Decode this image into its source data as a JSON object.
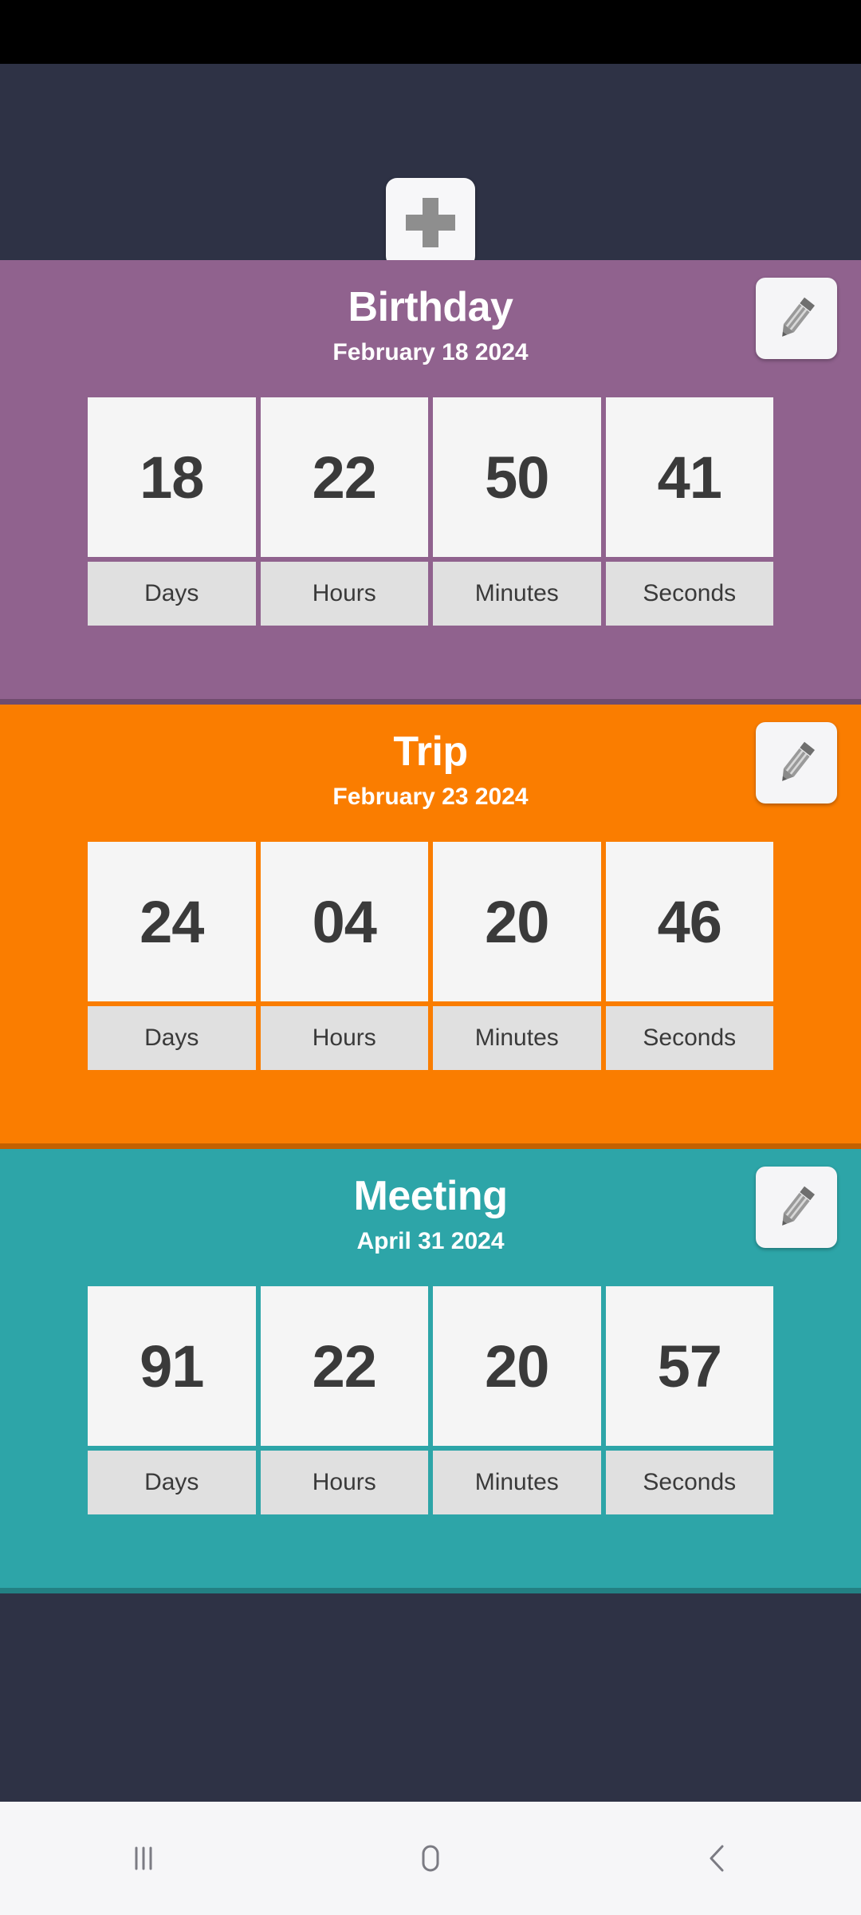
{
  "app": {
    "background_color": "#2e3245",
    "status_bar_color": "#000000"
  },
  "header": {
    "add_button_label": "+",
    "add_button_icon": "plus-icon",
    "button_background": "#f7f7f9",
    "icon_color": "#8e8e8e"
  },
  "cards": [
    {
      "title": "Birthday",
      "date": "February 18 2024",
      "color": "#90628e",
      "edit_icon": "pencil-icon",
      "countdown": [
        {
          "value": "18",
          "label": "Days"
        },
        {
          "value": "22",
          "label": "Hours"
        },
        {
          "value": "50",
          "label": "Minutes"
        },
        {
          "value": "41",
          "label": "Seconds"
        }
      ]
    },
    {
      "title": "Trip",
      "date": "February 23 2024",
      "color": "#fa7d00",
      "edit_icon": "pencil-icon",
      "countdown": [
        {
          "value": "24",
          "label": "Days"
        },
        {
          "value": "04",
          "label": "Hours"
        },
        {
          "value": "20",
          "label": "Minutes"
        },
        {
          "value": "46",
          "label": "Seconds"
        }
      ]
    },
    {
      "title": "Meeting",
      "date": "April 31 2024",
      "color": "#2da5a8",
      "edit_icon": "pencil-icon",
      "countdown": [
        {
          "value": "91",
          "label": "Days"
        },
        {
          "value": "22",
          "label": "Hours"
        },
        {
          "value": "20",
          "label": "Minutes"
        },
        {
          "value": "57",
          "label": "Seconds"
        }
      ]
    }
  ],
  "nav_bar": {
    "background": "#f6f6f8",
    "icon_color": "#7b7b83",
    "buttons": [
      {
        "name": "recents-icon",
        "label": "Recents"
      },
      {
        "name": "home-icon",
        "label": "Home"
      },
      {
        "name": "back-icon",
        "label": "Back"
      }
    ]
  }
}
